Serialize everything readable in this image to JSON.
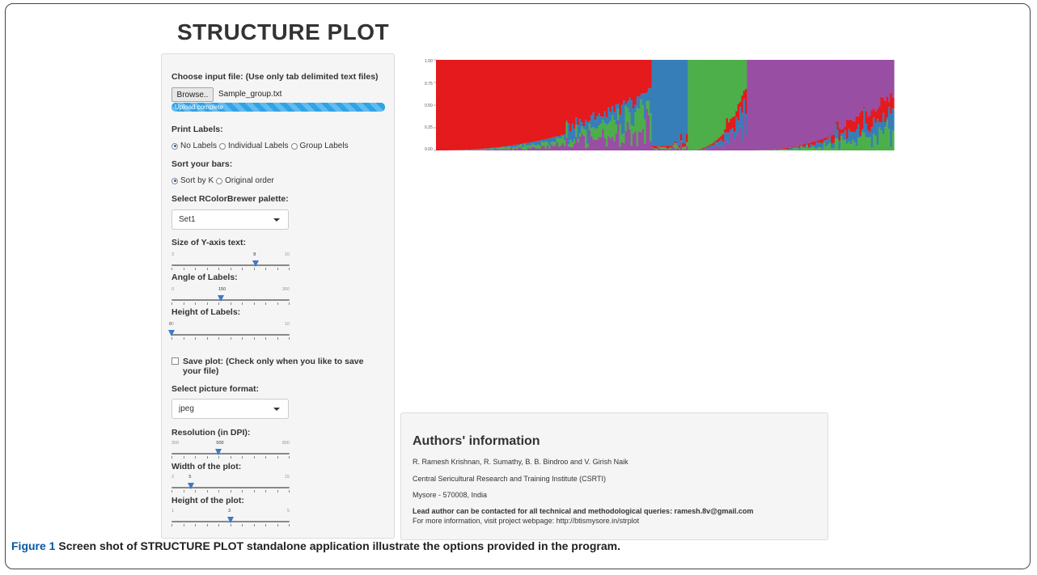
{
  "app": {
    "title": "STRUCTURE PLOT"
  },
  "file_input": {
    "label": "Choose input file: (Use only tab delimited text files)",
    "browse_label": "Browse..",
    "file_name": "Sample_group.txt",
    "progress_text": "Upload complete",
    "progress_value": 1.0
  },
  "print_labels": {
    "label": "Print Labels:",
    "options": [
      "No Labels",
      "Individual Labels",
      "Group Labels"
    ],
    "selected": "No Labels"
  },
  "sort_bars": {
    "label": "Sort your bars:",
    "options": [
      "Sort by K",
      "Original order"
    ],
    "selected": "Sort by K"
  },
  "palette": {
    "label": "Select RColorBrewer palette:",
    "value": "Set1"
  },
  "sliders": {
    "y_axis_text": {
      "label": "Size of Y-axis text:",
      "min": "3",
      "max": "10",
      "value": "8",
      "fraction": 0.714
    },
    "angle": {
      "label": "Angle of Labels:",
      "min": "0",
      "max": "360",
      "value": "150",
      "fraction": 0.417
    },
    "height_labels": {
      "label": "Height of Labels:",
      "min": "0",
      "max": "10",
      "value": "0",
      "fraction": 0.0
    },
    "resolution": {
      "label": "Resolution (in DPI):",
      "min": "300",
      "max": "800",
      "value": "500",
      "fraction": 0.4
    },
    "width_plot": {
      "label": "Width of the plot:",
      "min": "3",
      "max": "15",
      "value": "5",
      "fraction": 0.167
    },
    "height_plot": {
      "label": "Height of the plot:",
      "min": "1",
      "max": "5",
      "value": "3",
      "fraction": 0.5
    }
  },
  "save_plot": {
    "label": "Save plot: (Check only when you like to save your file)",
    "checked": false
  },
  "picture_format": {
    "label": "Select picture format:",
    "value": "jpeg"
  },
  "chart_data": {
    "type": "bar",
    "stacked": true,
    "title": "",
    "xlabel": "",
    "ylabel": "",
    "ylim": [
      0,
      1
    ],
    "yticks": [
      "0.00",
      "0.25",
      "0.50",
      "0.75",
      "1.00"
    ],
    "series": [
      {
        "color": "#e41a1c",
        "approx_individual_share": 0.47
      },
      {
        "color": "#377eb8",
        "approx_individual_share": 0.08
      },
      {
        "color": "#4daf4a",
        "approx_individual_share": 0.13
      },
      {
        "color": "#984ea3",
        "approx_individual_share": 0.32
      }
    ]
  },
  "authors": {
    "title": "Authors' information",
    "names": "R. Ramesh Krishnan, R. Sumathy, B. B. Bindroo and V. Girish Naik",
    "institute": "Central Sericultural Research and Training Institute (CSRTI)",
    "address": "Mysore - 570008, India",
    "contact": "Lead author can be contacted for all technical and methodological queries: ramesh.8v@gmail.com",
    "webpage": "For more information, visit project webpage: http://btismysore.in/strplot"
  },
  "caption": {
    "label": "Figure 1",
    "text": "Screen shot of STRUCTURE PLOT standalone application illustrate the options provided in the program."
  }
}
